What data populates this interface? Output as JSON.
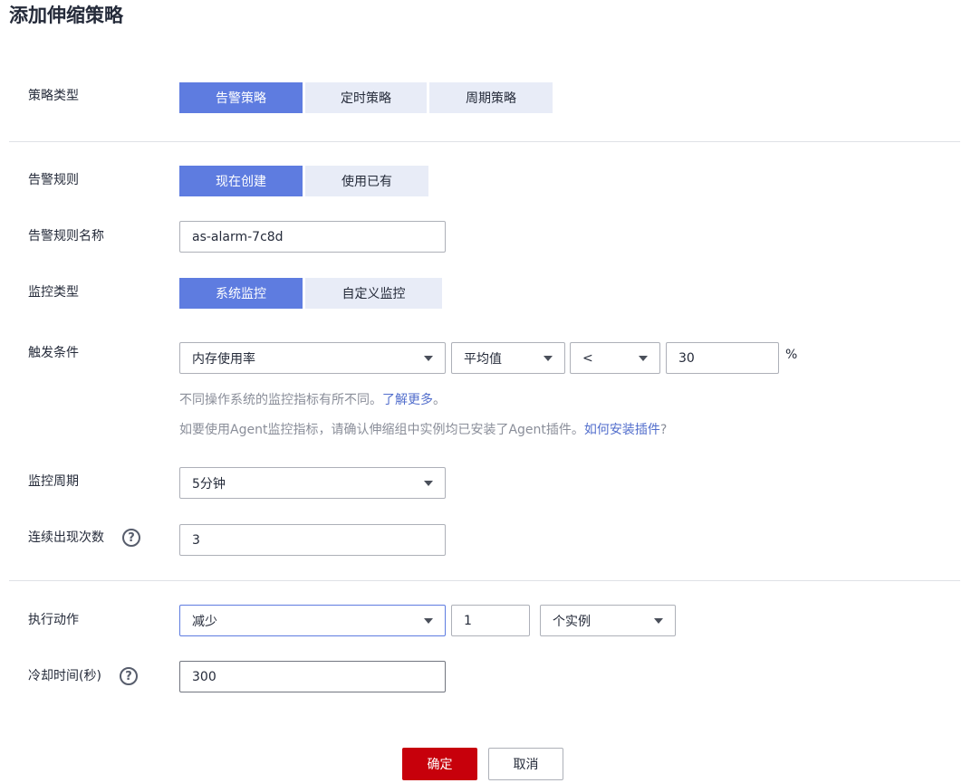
{
  "page_title": "添加伸缩策略",
  "policy_type": {
    "label": "策略类型",
    "options": [
      "告警策略",
      "定时策略",
      "周期策略"
    ],
    "selected": "告警策略"
  },
  "alarm_rule": {
    "label": "告警规则",
    "options": [
      "现在创建",
      "使用已有"
    ],
    "selected": "现在创建"
  },
  "alarm_rule_name": {
    "label": "告警规则名称",
    "value": "as-alarm-7c8d"
  },
  "monitor_type": {
    "label": "监控类型",
    "options": [
      "系统监控",
      "自定义监控"
    ],
    "selected": "系统监控"
  },
  "trigger": {
    "label": "触发条件",
    "metric": "内存使用率",
    "aggregation": "平均值",
    "operator": "<",
    "threshold": "30",
    "unit": "%",
    "hint1_text": "不同操作系统的监控指标有所不同。",
    "hint1_link": "了解更多",
    "hint1_end": "。",
    "hint2_text": "如要使用Agent监控指标，请确认伸缩组中实例均已安装了Agent插件。",
    "hint2_link": "如何安装插件",
    "hint2_end": "?"
  },
  "monitor_period": {
    "label": "监控周期",
    "value": "5分钟"
  },
  "consecutive": {
    "label": "连续出现次数",
    "value": "3"
  },
  "action": {
    "label": "执行动作",
    "operation": "减少",
    "count": "1",
    "unit": "个实例"
  },
  "cooldown": {
    "label": "冷却时间(秒)",
    "value": "300"
  },
  "help_glyph": "?",
  "footer": {
    "confirm": "确定",
    "cancel": "取消"
  },
  "colors": {
    "primary": "#5e7ce0",
    "confirm": "#c7000b",
    "link": "#526ecc"
  }
}
